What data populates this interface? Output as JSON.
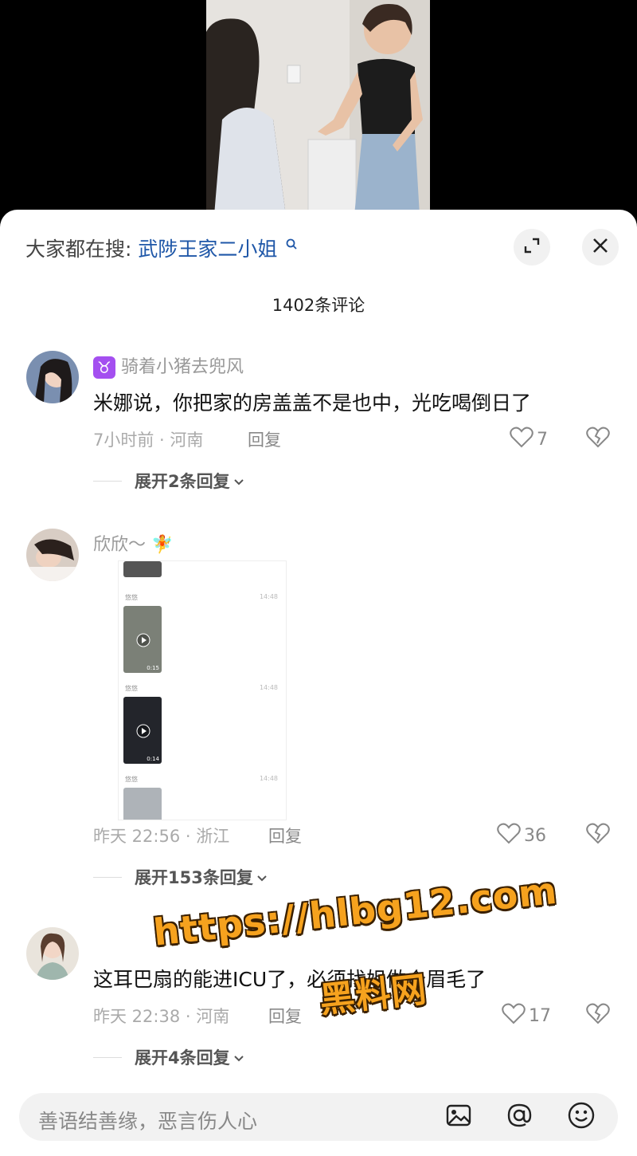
{
  "search_bar": {
    "prefix": "大家都在搜:",
    "term": "武陟王家二小姐"
  },
  "comment_count": "1402条评论",
  "comments": [
    {
      "zodiac_icon": "♉",
      "username": "骑着小猪去兜风",
      "text": "米娜说，你把家的房盖盖不是也中，光吃喝倒日了",
      "meta": "7小时前 · 河南",
      "reply": "回复",
      "likes": "7",
      "expand": "展开2条回复"
    },
    {
      "username": "欣欣～",
      "username_emoji": "🧚",
      "attachment": {
        "rows": [
          {
            "sender": "悠悠",
            "time": "14:48",
            "duration": "0:15"
          },
          {
            "sender": "悠悠",
            "time": "14:48",
            "duration": "0:14"
          },
          {
            "sender": "悠悠",
            "time": "14:48"
          }
        ]
      },
      "meta": "昨天 22:56 · 浙江",
      "reply": "回复",
      "likes": "36",
      "expand": "展开153条回复"
    },
    {
      "text": "这耳巴扇的能进ICU了，必须找姐做个眉毛了",
      "meta": "昨天 22:38 · 河南",
      "reply": "回复",
      "likes": "17",
      "expand": "展开4条回复"
    }
  ],
  "watermark": {
    "line1": "https://hlbg12.com",
    "line2": "黑料网"
  },
  "input": {
    "placeholder": "善语结善缘，恶言伤人心"
  },
  "colors": {
    "link": "#1f57a8",
    "watermark": "#f6a21e"
  }
}
